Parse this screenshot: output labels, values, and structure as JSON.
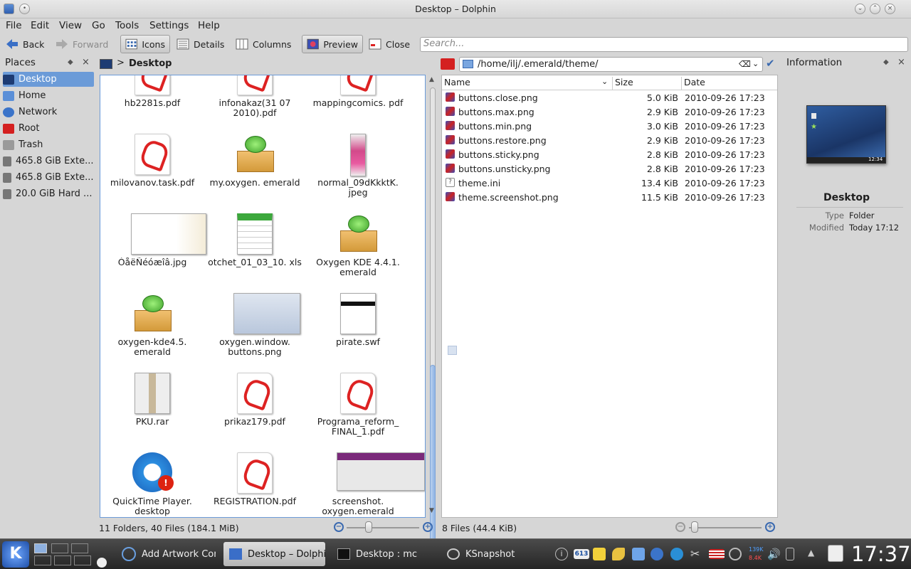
{
  "window": {
    "title": "Desktop – Dolphin"
  },
  "menu": [
    "File",
    "Edit",
    "View",
    "Go",
    "Tools",
    "Settings",
    "Help"
  ],
  "toolbar": {
    "back": "Back",
    "forward": "Forward",
    "icons": "Icons",
    "details": "Details",
    "columns": "Columns",
    "preview": "Preview",
    "close": "Close",
    "search_placeholder": "Search..."
  },
  "places": {
    "title": "Places",
    "items": [
      {
        "label": "Desktop",
        "color": "#3a6ec8"
      },
      {
        "label": "Home",
        "color": "#5a8fd8"
      },
      {
        "label": "Network",
        "color": "#3b74c9"
      },
      {
        "label": "Root",
        "color": "#d42020"
      },
      {
        "label": "Trash",
        "color": "#9a9a9a"
      },
      {
        "label": "465.8 GiB Exte...",
        "color": "#777777"
      },
      {
        "label": "465.8 GiB Exte...",
        "color": "#777777"
      },
      {
        "label": "20.0 GiB Hard ...",
        "color": "#777777"
      }
    ]
  },
  "left": {
    "breadcrumb": "Desktop",
    "files": [
      {
        "name": "hb2281s.pdf",
        "kind": "pdf"
      },
      {
        "name": "infonakaz(31 07 2010).pdf",
        "kind": "pdf"
      },
      {
        "name": "mappingcomics. pdf",
        "kind": "pdf"
      },
      {
        "name": "milovanov.task.pdf",
        "kind": "pdf"
      },
      {
        "name": "my.oxygen. emerald",
        "kind": "box"
      },
      {
        "name": "normal_09dKkktK. jpeg",
        "kind": "photo"
      },
      {
        "name": "ÒåëÑéóæîâ.jpg",
        "kind": "card"
      },
      {
        "name": "otchet_01_03_10. xls",
        "kind": "xls"
      },
      {
        "name": "Oxygen KDE 4.4.1. emerald",
        "kind": "box"
      },
      {
        "name": "oxygen-kde4.5. emerald",
        "kind": "box"
      },
      {
        "name": "oxygen.window. buttons.png",
        "kind": "shot"
      },
      {
        "name": "pirate.swf",
        "kind": "clap"
      },
      {
        "name": "PKU.rar",
        "kind": "zip"
      },
      {
        "name": "prikaz179.pdf",
        "kind": "pdf"
      },
      {
        "name": "Programa_reform_ FINAL_1.pdf",
        "kind": "pdf"
      },
      {
        "name": "QuickTime Player. desktop",
        "kind": "qt"
      },
      {
        "name": "REGISTRATION.pdf",
        "kind": "pdf"
      },
      {
        "name": "screenshot. oxygen.emerald",
        "kind": "win"
      }
    ],
    "status": "11 Folders, 40 Files (184.1 MiB)"
  },
  "right": {
    "path": "/home/ilj/.emerald/theme/",
    "columns": [
      "Name",
      "Size",
      "Date"
    ],
    "rows": [
      {
        "name": "buttons.close.png",
        "size": "5.0 KiB",
        "date": "2010-09-26 17:23",
        "ico": "img"
      },
      {
        "name": "buttons.max.png",
        "size": "2.9 KiB",
        "date": "2010-09-26 17:23",
        "ico": "img"
      },
      {
        "name": "buttons.min.png",
        "size": "3.0 KiB",
        "date": "2010-09-26 17:23",
        "ico": "img"
      },
      {
        "name": "buttons.restore.png",
        "size": "2.9 KiB",
        "date": "2010-09-26 17:23",
        "ico": "img"
      },
      {
        "name": "buttons.sticky.png",
        "size": "2.8 KiB",
        "date": "2010-09-26 17:23",
        "ico": "img"
      },
      {
        "name": "buttons.unsticky.png",
        "size": "2.8 KiB",
        "date": "2010-09-26 17:23",
        "ico": "img"
      },
      {
        "name": "theme.ini",
        "size": "13.4 KiB",
        "date": "2010-09-26 17:23",
        "ico": "txt"
      },
      {
        "name": "theme.screenshot.png",
        "size": "11.5 KiB",
        "date": "2010-09-26 17:23",
        "ico": "img"
      }
    ],
    "status": "8 Files (44.4 KiB)"
  },
  "info": {
    "title": "Information",
    "name": "Desktop",
    "type_label": "Type",
    "type_value": "Folder",
    "mod_label": "Modified",
    "mod_value": "Today 17:12",
    "preview_clock": "12:34"
  },
  "taskbar": {
    "tasks": [
      "Add Artwork Con",
      "Desktop – Dolphi",
      "Desktop : mc",
      "KSnapshot"
    ],
    "clock": "17:37",
    "net_up": "139K",
    "net_down": "8.4K",
    "badge": "613"
  }
}
